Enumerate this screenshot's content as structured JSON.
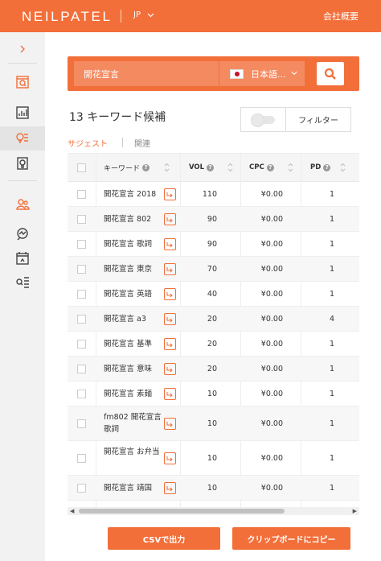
{
  "header": {
    "logo": "NEILPATEL",
    "language": "JP",
    "company_link": "会社概要"
  },
  "colors": {
    "accent": "#f26f3a",
    "accent_light": "#f48a5f"
  },
  "sidebar": {
    "items": [
      {
        "icon": "chevron-right-icon"
      },
      {
        "icon": "site-audit-icon"
      },
      {
        "icon": "chart-icon"
      },
      {
        "icon": "keyword-ideas-icon",
        "active": true
      },
      {
        "icon": "content-ideas-icon"
      },
      {
        "icon": "competitor-icon"
      },
      {
        "icon": "backlinks-icon"
      },
      {
        "icon": "rank-tracking-icon"
      },
      {
        "icon": "keyword-list-icon"
      }
    ]
  },
  "search": {
    "value": "開花宣言",
    "language_label": "日本語...",
    "button_icon": "search-icon"
  },
  "results": {
    "title": "13 キーワード候補",
    "filter_label": "フィルター",
    "tabs": [
      "サジェスト",
      "関連"
    ]
  },
  "table": {
    "headers": {
      "keyword": "キーワード",
      "vol": "VOL",
      "cpc": "CPC",
      "pd": "PD"
    },
    "rows": [
      {
        "keyword": "開花宣言 2018",
        "vol": "110",
        "cpc": "¥0.00",
        "pd": "1"
      },
      {
        "keyword": "開花宣言 802",
        "vol": "90",
        "cpc": "¥0.00",
        "pd": "1"
      },
      {
        "keyword": "開花宣言 歌詞",
        "vol": "90",
        "cpc": "¥0.00",
        "pd": "1"
      },
      {
        "keyword": "開花宣言 東京",
        "vol": "70",
        "cpc": "¥0.00",
        "pd": "1"
      },
      {
        "keyword": "開花宣言 英語",
        "vol": "40",
        "cpc": "¥0.00",
        "pd": "1"
      },
      {
        "keyword": "開花宣言 a3",
        "vol": "20",
        "cpc": "¥0.00",
        "pd": "4"
      },
      {
        "keyword": "開花宣言 基準",
        "vol": "20",
        "cpc": "¥0.00",
        "pd": "1"
      },
      {
        "keyword": "開花宣言 意味",
        "vol": "20",
        "cpc": "¥0.00",
        "pd": "1"
      },
      {
        "keyword": "開花宣言 素麺",
        "vol": "10",
        "cpc": "¥0.00",
        "pd": "1"
      },
      {
        "keyword": "fm802 開花宣言 歌詞",
        "vol": "10",
        "cpc": "¥0.00",
        "pd": "1"
      },
      {
        "keyword": "開花宣言 お弁当",
        "vol": "10",
        "cpc": "¥0.00",
        "pd": "1"
      },
      {
        "keyword": "開花宣言 靖国",
        "vol": "10",
        "cpc": "¥0.00",
        "pd": "1"
      }
    ]
  },
  "actions": {
    "csv": "CSVで出力",
    "clipboard": "クリップボードにコピー"
  }
}
